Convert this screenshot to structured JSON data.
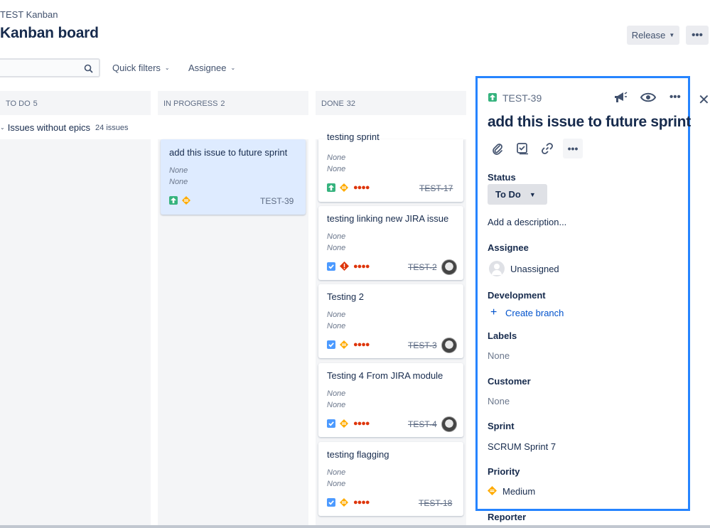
{
  "header": {
    "breadcrumb": "TEST Kanban",
    "title": "Kanban board",
    "release_label": "Release",
    "more_label": "•••"
  },
  "filters": {
    "search_value": "",
    "quick_filters": "Quick filters",
    "assignee": "Assignee"
  },
  "columns": [
    {
      "name": "TO DO",
      "count": "5"
    },
    {
      "name": "IN PROGRESS",
      "count": "2"
    },
    {
      "name": "DONE",
      "count": "32"
    }
  ],
  "swimlane": {
    "label": "Issues without epics",
    "count": "24 issues"
  },
  "in_progress_cards": [
    {
      "title": "add this issue to future sprint",
      "field1": "None",
      "field2": "None",
      "key": "TEST-39",
      "type": "story",
      "priority": "medium"
    }
  ],
  "done_cards": [
    {
      "title": "testing sprint",
      "field1": "None",
      "field2": "None",
      "key": "TEST-17",
      "type": "story",
      "priority": "medium",
      "avatar": false
    },
    {
      "title": "testing linking new JIRA issue",
      "field1": "None",
      "field2": "None",
      "key": "TEST-2",
      "type": "task",
      "priority": "highest",
      "avatar": true
    },
    {
      "title": "Testing 2",
      "field1": "None",
      "field2": "None",
      "key": "TEST-3",
      "type": "task",
      "priority": "medium",
      "avatar": true
    },
    {
      "title": "Testing 4 From JIRA module",
      "field1": "None",
      "field2": "None",
      "key": "TEST-4",
      "type": "task",
      "priority": "medium",
      "avatar": true
    },
    {
      "title": "testing flagging",
      "field1": "None",
      "field2": "None",
      "key": "TEST-18",
      "type": "task",
      "priority": "medium",
      "avatar": false
    }
  ],
  "card_dots": "●●●●",
  "detail": {
    "key": "TEST-39",
    "title": "add this issue to future sprint",
    "status_label": "Status",
    "status_value": "To Do",
    "description_placeholder": "Add a description...",
    "assignee_label": "Assignee",
    "assignee_value": "Unassigned",
    "development_label": "Development",
    "create_branch": "Create branch",
    "labels_label": "Labels",
    "labels_value": "None",
    "customer_label": "Customer",
    "customer_value": "None",
    "sprint_label": "Sprint",
    "sprint_value": "SCRUM Sprint 7",
    "priority_label": "Priority",
    "priority_value": "Medium",
    "reporter_label": "Reporter"
  },
  "colors": {
    "accent": "#2684ff",
    "story_green": "#36b37e",
    "task_blue": "#4c9aff",
    "priority_medium": "#ffab00",
    "priority_highest": "#de350b"
  }
}
